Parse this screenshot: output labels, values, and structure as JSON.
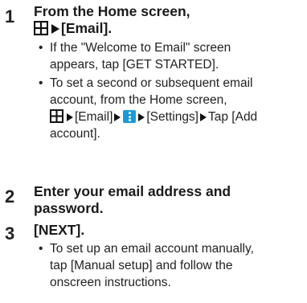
{
  "steps": [
    {
      "number": "1",
      "title_line1": "From the Home screen,",
      "title_line2": "[Email].",
      "bullets": [
        {
          "dot": "•",
          "line1": "If the \"Welcome to Email\" screen",
          "line2": "appears, tap [GET STARTED]."
        },
        {
          "dot": "•",
          "line1": "To set a second or subsequent email",
          "line2": "account, from the Home screen,",
          "line3_a": "[Email]",
          "line3_b": "[Settings]",
          "line3_c": "Tap [Add",
          "line4": "account]."
        }
      ]
    },
    {
      "number": "2",
      "title_line1": "Enter your email address and",
      "title_line2": "password."
    },
    {
      "number": "3",
      "title_line1": "[NEXT].",
      "bullets": [
        {
          "dot": "•",
          "line1": "To set up an email account manually,",
          "line2": "tap [Manual setup] and follow the",
          "line3": "onscreen instructions."
        }
      ]
    }
  ],
  "icons": {
    "apps": "apps-grid-icon",
    "arrow": "right-triangle-icon",
    "menu": "menu-dots-icon",
    "menu_color": "#1a9ad6"
  }
}
